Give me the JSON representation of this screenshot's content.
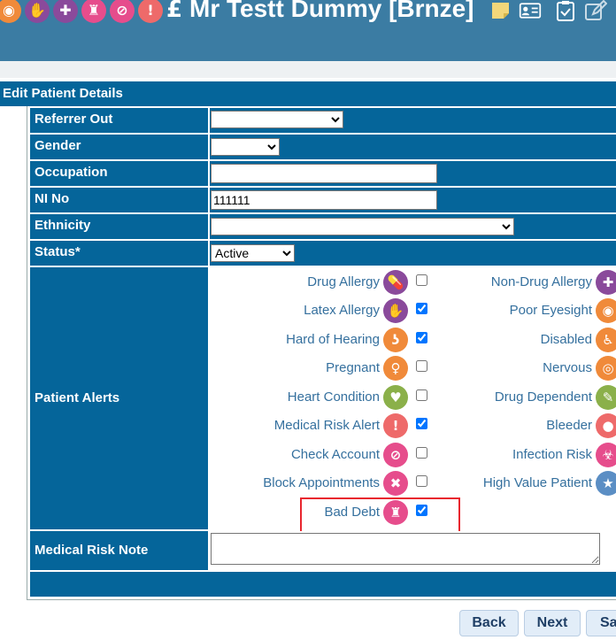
{
  "header": {
    "currency_symbol": "£",
    "patient_name": "Mr Testt Dummy [Brnze]",
    "icons": [
      {
        "name": "eye-icon",
        "glyph": "◉",
        "color": "#f08a3a"
      },
      {
        "name": "hand-icon",
        "glyph": "✋",
        "color": "#8a4a9b"
      },
      {
        "name": "plus-cross-icon",
        "glyph": "✚",
        "color": "#8a4a9b"
      },
      {
        "name": "siren-icon",
        "glyph": "♜",
        "color": "#e64d8c"
      },
      {
        "name": "no-entry-icon",
        "glyph": "⊘",
        "color": "#e64d8c"
      },
      {
        "name": "exclamation-icon",
        "glyph": "!",
        "color": "#ee6a6a"
      }
    ]
  },
  "panel": {
    "title": "Edit Patient Details"
  },
  "form": {
    "referrer_out": {
      "label": "Referrer Out",
      "value": ""
    },
    "gender": {
      "label": "Gender",
      "value": ""
    },
    "occupation": {
      "label": "Occupation",
      "value": ""
    },
    "ni_no": {
      "label": "NI No",
      "value": "111111"
    },
    "ethnicity": {
      "label": "Ethnicity",
      "value": ""
    },
    "status": {
      "label": "Status*",
      "value": "Active"
    },
    "patient_alerts_label": "Patient Alerts",
    "medical_risk_note": {
      "label": "Medical Risk Note",
      "value": ""
    }
  },
  "alerts_left": [
    {
      "label": "Drug Allergy",
      "icon": "pill-icon",
      "glyph": "💊",
      "color": "#8a4a9b",
      "checked": false
    },
    {
      "label": "Latex Allergy",
      "icon": "hand-icon",
      "glyph": "✋",
      "color": "#8a4a9b",
      "checked": true
    },
    {
      "label": "Hard of Hearing",
      "icon": "ear-icon",
      "glyph": "ʖ",
      "color": "#f08a3a",
      "checked": true
    },
    {
      "label": "Pregnant",
      "icon": "pregnant-icon",
      "glyph": "♀",
      "color": "#f08a3a",
      "checked": false
    },
    {
      "label": "Heart Condition",
      "icon": "heart-monitor-icon",
      "glyph": "♥",
      "color": "#8bb04a",
      "checked": false
    },
    {
      "label": "Medical Risk Alert",
      "icon": "exclamation-icon",
      "glyph": "!",
      "color": "#ee6a6a",
      "checked": true
    },
    {
      "label": "Check Account",
      "icon": "no-entry-icon",
      "glyph": "⊘",
      "color": "#e64d8c",
      "checked": false
    },
    {
      "label": "Block Appointments",
      "icon": "x-icon",
      "glyph": "✖",
      "color": "#e64d8c",
      "checked": false
    },
    {
      "label": "Bad Debt",
      "icon": "siren-icon",
      "glyph": "♜",
      "color": "#e64d8c",
      "checked": true
    }
  ],
  "alerts_right": [
    {
      "label": "Non-Drug Allergy",
      "icon": "plus-cross-icon",
      "glyph": "✚",
      "color": "#8a4a9b"
    },
    {
      "label": "Poor Eyesight",
      "icon": "eye-icon",
      "glyph": "◉",
      "color": "#f08a3a"
    },
    {
      "label": "Disabled",
      "icon": "wheelchair-icon",
      "glyph": "♿",
      "color": "#f08a3a"
    },
    {
      "label": "Nervous",
      "icon": "vibrate-icon",
      "glyph": "◎",
      "color": "#f08a3a"
    },
    {
      "label": "Drug Dependent",
      "icon": "syringe-icon",
      "glyph": "✎",
      "color": "#8bb04a"
    },
    {
      "label": "Bleeder",
      "icon": "blood-drop-icon",
      "glyph": "●",
      "color": "#ee6a6a"
    },
    {
      "label": "Infection Risk",
      "icon": "biohazard-icon",
      "glyph": "☣",
      "color": "#e64d8c"
    },
    {
      "label": "High Value Patient",
      "icon": "star-icon",
      "glyph": "★",
      "color": "#5b8ec4"
    }
  ],
  "buttons": {
    "back": "Back",
    "next": "Next",
    "save": "Sa"
  }
}
